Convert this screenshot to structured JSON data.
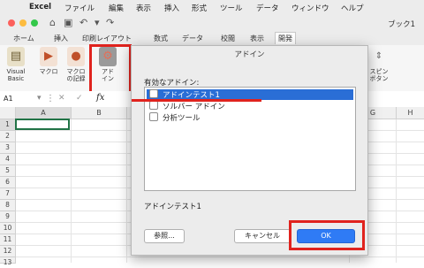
{
  "menubar": {
    "app": "Excel",
    "items": [
      "ファイル",
      "編集",
      "表示",
      "挿入",
      "形式",
      "ツール",
      "データ",
      "ウィンドウ",
      "ヘルプ"
    ]
  },
  "window": {
    "title": "ブック1"
  },
  "ribbon": {
    "tabs": [
      "ホーム",
      "挿入",
      "印刷レイアウト",
      "数式",
      "データ",
      "校閲",
      "表示",
      "開発"
    ],
    "active_tab": "開発",
    "buttons": {
      "vba": "Visual\nBasic",
      "macro": "マクロ",
      "record": "マクロ\nの記録",
      "addin": "アド\nイン",
      "spin": "スピン\nボタン"
    }
  },
  "formula_bar": {
    "cell_ref": "A1",
    "fx": "fx"
  },
  "sheet": {
    "columns": [
      "A",
      "B",
      "C",
      "D",
      "E",
      "F",
      "G",
      "H"
    ],
    "rows": [
      "1",
      "2",
      "3",
      "4",
      "5",
      "6",
      "7",
      "8",
      "9",
      "10",
      "11",
      "12",
      "13"
    ]
  },
  "dialog": {
    "title": "アドイン",
    "list_label": "有効なアドイン:",
    "items": [
      {
        "label": "アドインテスト1",
        "checked": false,
        "selected": true
      },
      {
        "label": "ソルバー アドイン",
        "checked": false,
        "selected": false
      },
      {
        "label": "分析ツール",
        "checked": false,
        "selected": false
      }
    ],
    "description": "アドインテスト1",
    "browse_button": "参照...",
    "cancel_button": "キャンセル",
    "ok_button": "OK"
  },
  "colors": {
    "highlight": "#e0231e",
    "selection": "#2a6ed6",
    "ok": "#2f7bf5"
  }
}
